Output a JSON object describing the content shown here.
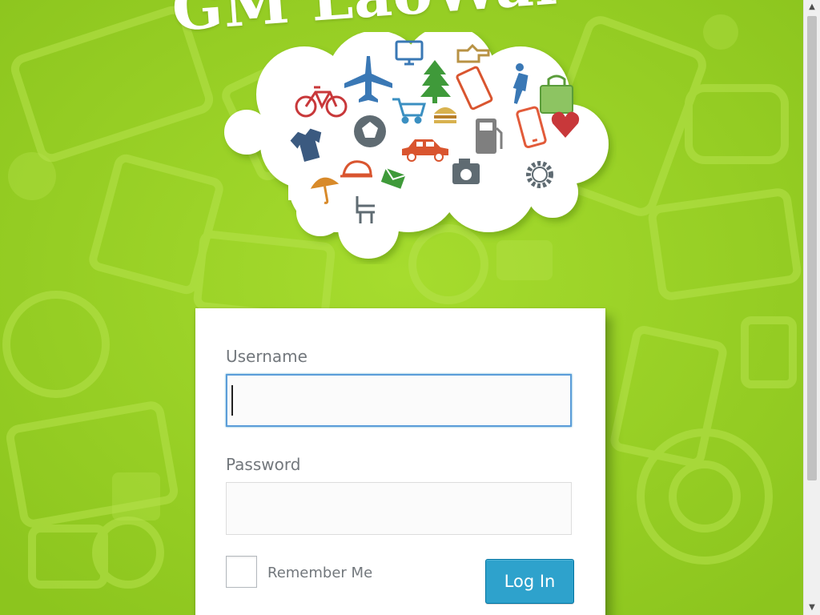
{
  "brand": {
    "title": "GM LaoWai"
  },
  "login_form": {
    "username_label": "Username",
    "username_value": "",
    "password_label": "Password",
    "password_value": "",
    "remember_label": "Remember Me",
    "remember_checked": false,
    "submit_label": "Log In"
  },
  "colors": {
    "background": "#95d024",
    "button": "#2ea2cc",
    "focus_border": "#5b9dd9",
    "label_text": "#72777c"
  },
  "cloud_icons": [
    "bicycle-icon",
    "airplane-icon",
    "monitor-icon",
    "tree-icon",
    "hand-icon",
    "person-icon",
    "shopping-bag-icon",
    "shopping-cart-icon",
    "burger-icon",
    "phone-icon",
    "tablet-icon",
    "heart-icon",
    "gas-pump-icon",
    "soccer-ball-icon",
    "car-icon",
    "t-shirt-icon",
    "cap-icon",
    "envelope-icon",
    "camera-icon",
    "gear-icon",
    "umbrella-icon",
    "chair-icon"
  ]
}
